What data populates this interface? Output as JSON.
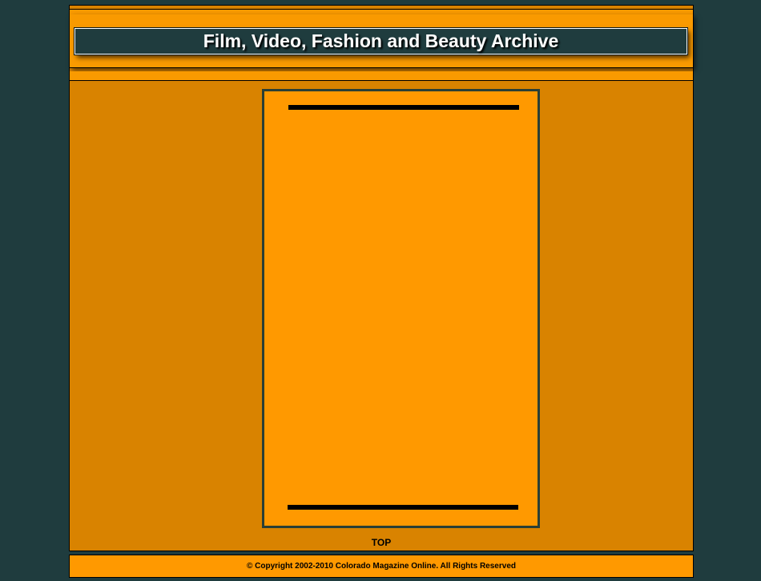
{
  "header": {
    "title": "Film, Video, Fashion and Beauty Archive"
  },
  "main": {
    "top_link_label": "TOP"
  },
  "footer": {
    "copyright": "© Copyright 2002-2010  Colorado Magazine Online.  All Rights Reserved"
  },
  "colors": {
    "page_background": "#1f3c3e",
    "frame_orange": "#d98300",
    "panel_orange": "#ff9900",
    "title_box": "#1f3c3e"
  }
}
